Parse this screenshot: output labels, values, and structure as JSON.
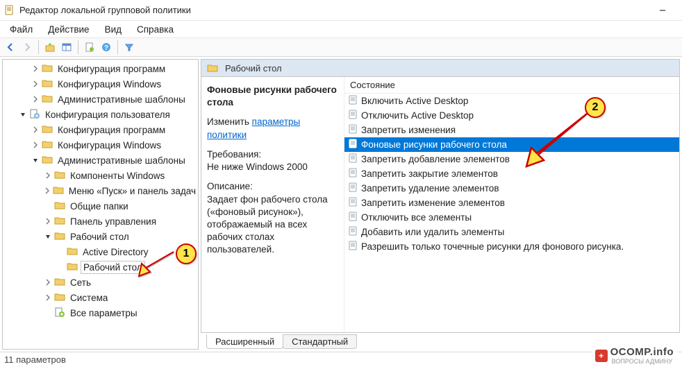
{
  "window": {
    "title": "Редактор локальной групповой политики"
  },
  "menubar": [
    "Файл",
    "Действие",
    "Вид",
    "Справка"
  ],
  "toolbar_icons": [
    "back",
    "forward",
    "up",
    "panes",
    "delete",
    "help",
    "filter"
  ],
  "tree": [
    {
      "indent": 2,
      "exp": "closed",
      "icon": "folder",
      "label": "Конфигурация программ"
    },
    {
      "indent": 2,
      "exp": "closed",
      "icon": "folder",
      "label": "Конфигурация Windows"
    },
    {
      "indent": 2,
      "exp": "closed",
      "icon": "folder",
      "label": "Административные шаблоны"
    },
    {
      "indent": 1,
      "exp": "open",
      "icon": "cfg",
      "label": "Конфигурация пользователя"
    },
    {
      "indent": 2,
      "exp": "closed",
      "icon": "folder",
      "label": "Конфигурация программ"
    },
    {
      "indent": 2,
      "exp": "closed",
      "icon": "folder",
      "label": "Конфигурация Windows"
    },
    {
      "indent": 2,
      "exp": "open",
      "icon": "folder",
      "label": "Административные шаблоны"
    },
    {
      "indent": 3,
      "exp": "closed",
      "icon": "folder",
      "label": "Компоненты Windows"
    },
    {
      "indent": 3,
      "exp": "closed",
      "icon": "folder",
      "label": "Меню «Пуск» и панель задач"
    },
    {
      "indent": 3,
      "exp": "blank",
      "icon": "folder",
      "label": "Общие папки"
    },
    {
      "indent": 3,
      "exp": "closed",
      "icon": "folder",
      "label": "Панель управления"
    },
    {
      "indent": 3,
      "exp": "open",
      "icon": "folder",
      "label": "Рабочий стол"
    },
    {
      "indent": 4,
      "exp": "blank",
      "icon": "folder",
      "label": "Active Directory"
    },
    {
      "indent": 4,
      "exp": "blank",
      "icon": "folder",
      "label": "Рабочий стол",
      "selected": true
    },
    {
      "indent": 3,
      "exp": "closed",
      "icon": "folder",
      "label": "Сеть"
    },
    {
      "indent": 3,
      "exp": "closed",
      "icon": "folder",
      "label": "Система"
    },
    {
      "indent": 3,
      "exp": "blank",
      "icon": "all",
      "label": "Все параметры"
    }
  ],
  "right_header": "Рабочий стол",
  "detail": {
    "title": "Фоновые рисунки рабочего стола",
    "edit_label": "Изменить",
    "edit_link": "параметры политики",
    "req_label": "Требования:",
    "req_value": "Не ниже Windows 2000",
    "desc_label": "Описание:",
    "desc_value": "Задает фон рабочего стола («фоновый рисунок»), отображаемый на всех рабочих столах пользователей."
  },
  "list_header": "Состояние",
  "settings": [
    "Включить Active Desktop",
    "Отключить Active Desktop",
    "Запретить изменения",
    "Фоновые рисунки рабочего стола",
    "Запретить добавление элементов",
    "Запретить закрытие элементов",
    "Запретить удаление элементов",
    "Запретить изменение элементов",
    "Отключить все элементы",
    "Добавить или удалить элементы",
    "Разрешить только точечные рисунки для фонового рисунка."
  ],
  "selected_setting_index": 3,
  "tabs": {
    "extended": "Расширенный",
    "standard": "Стандартный"
  },
  "statusbar": "11 параметров",
  "badges": {
    "one": "1",
    "two": "2"
  },
  "watermark": {
    "brand": "OCOMP",
    "tld": ".info",
    "sub": "ВОПРОСЫ АДМИНУ"
  }
}
